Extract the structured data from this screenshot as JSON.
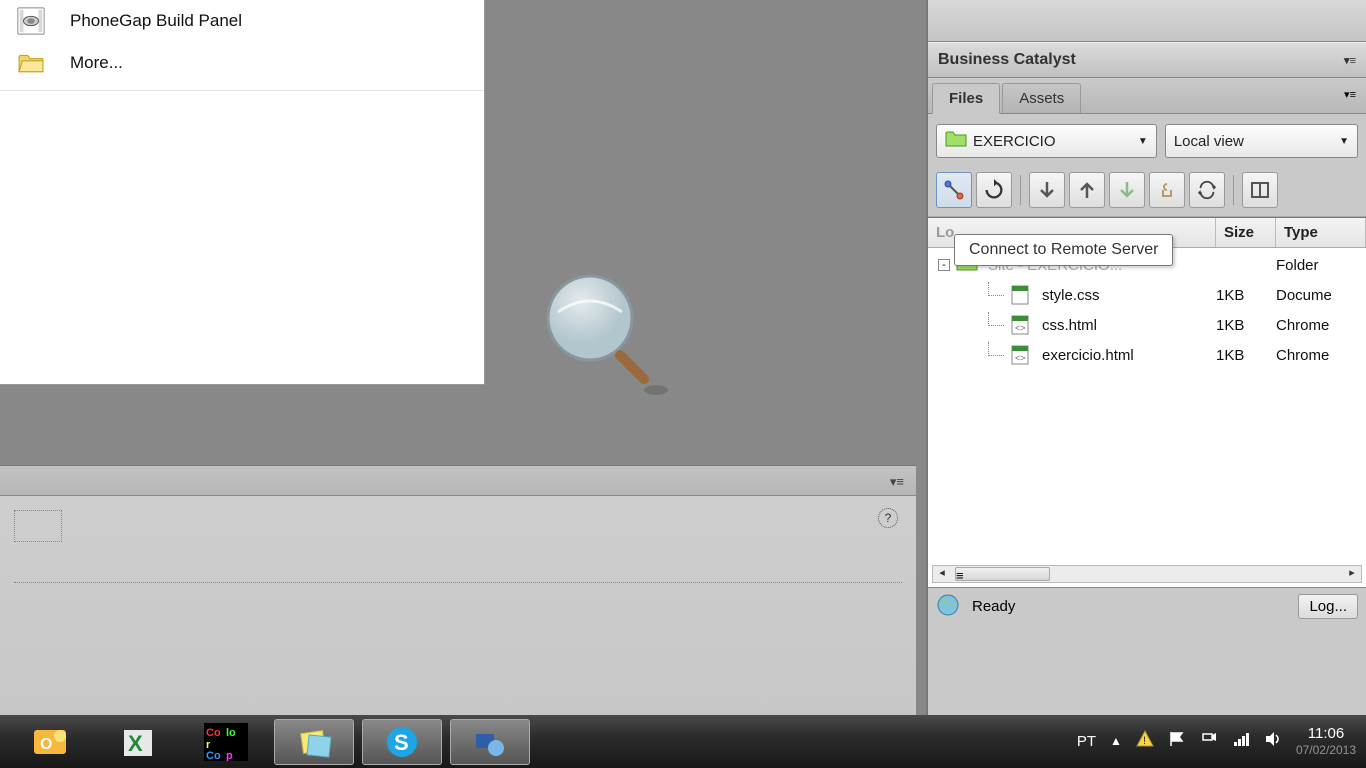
{
  "menu": {
    "items": [
      {
        "label": "PhoneGap Build Panel",
        "icon": "camera"
      },
      {
        "label": "More...",
        "icon": "folder"
      }
    ]
  },
  "right": {
    "panel1_title": "Business Catalyst",
    "tabs": [
      {
        "label": "Files",
        "active": true
      },
      {
        "label": "Assets",
        "active": false
      }
    ],
    "site_dropdown": "EXERCICIO",
    "view_dropdown": "Local view",
    "tooltip_text": "Connect to Remote Server",
    "table": {
      "headers": {
        "name": "Local Files",
        "size": "Size",
        "type": "Type"
      },
      "rows": [
        {
          "name": "Site - EXERCICIO...",
          "size": "",
          "type": "Folder",
          "indent": 0,
          "icon": "sitefolder"
        },
        {
          "name": "style.css",
          "size": "1KB",
          "type": "Docume",
          "indent": 1,
          "icon": "css"
        },
        {
          "name": "css.html",
          "size": "1KB",
          "type": "Chrome",
          "indent": 1,
          "icon": "html"
        },
        {
          "name": "exercicio.html",
          "size": "1KB",
          "type": "Chrome",
          "indent": 1,
          "icon": "html"
        }
      ]
    },
    "status_text": "Ready",
    "log_label": "Log..."
  },
  "tray": {
    "lang": "PT",
    "time": "11:06",
    "date": "07/02/2013"
  }
}
